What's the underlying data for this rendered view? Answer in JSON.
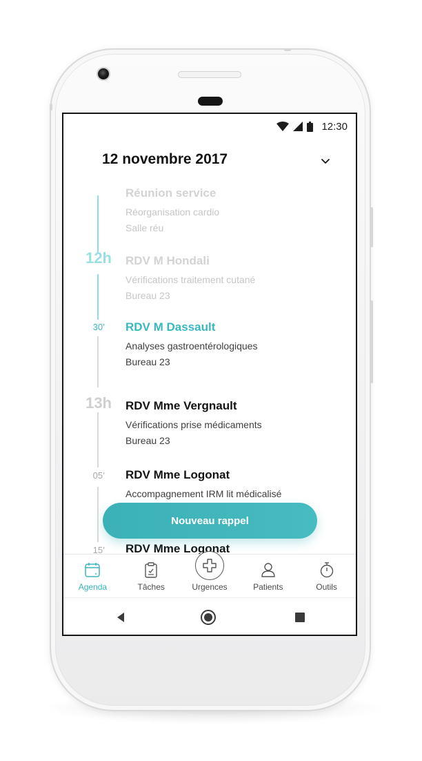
{
  "status_bar": {
    "time": "12:30"
  },
  "header": {
    "date": "12 novembre 2017"
  },
  "timeline": {
    "time_labels": {
      "h12": "12h",
      "m30": "30’",
      "h13": "13h",
      "m05": "05’",
      "m15": "15’"
    },
    "events": [
      {
        "title": "Réunion service",
        "description": "Réorganisation cardio",
        "room": "Salle réu"
      },
      {
        "title": "RDV M Hondali",
        "description": "Vérifications traitement cutané",
        "room": "Bureau 23"
      },
      {
        "title": "RDV M Dassault",
        "description": "Analyses gastroentérologiques",
        "room": "Bureau 23"
      },
      {
        "title": "RDV Mme Vergnault",
        "description": "Vérifications prise médicaments",
        "room": "Bureau 23"
      },
      {
        "title": "RDV Mme Logonat",
        "description": "Accompagnement IRM lit médicalisé",
        "room": ""
      },
      {
        "title": "RDV Mme Logonat",
        "description": "",
        "room": ""
      }
    ]
  },
  "fab": {
    "label": "Nouveau rappel"
  },
  "bottom_nav": {
    "items": [
      {
        "label": "Agenda",
        "icon": "calendar-icon",
        "selected": true
      },
      {
        "label": "Tâches",
        "icon": "clipboard-icon",
        "selected": false
      },
      {
        "label": "Urgences",
        "icon": "medical-cross-icon",
        "selected": false
      },
      {
        "label": "Patients",
        "icon": "person-icon",
        "selected": false
      },
      {
        "label": "Outils",
        "icon": "stopwatch-icon",
        "selected": false
      }
    ]
  },
  "colors": {
    "accent": "#39b8bd",
    "faded_text": "#d3d3d3",
    "dark_text": "#141414"
  }
}
